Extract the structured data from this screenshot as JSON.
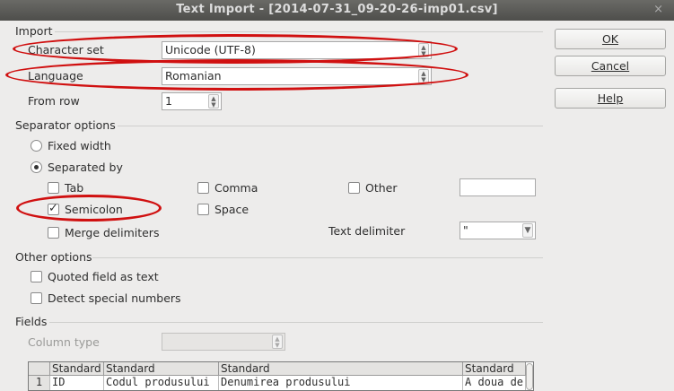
{
  "window": {
    "title": "Text Import - [2014-07-31_09-20-26-imp01.csv]",
    "close_glyph": "×"
  },
  "import": {
    "heading": "Import",
    "character_set_label": "Character set",
    "character_set_value": "Unicode (UTF-8)",
    "language_label": "Language",
    "language_value": "Romanian",
    "from_row_label": "From row",
    "from_row_value": "1"
  },
  "buttons": {
    "ok": "OK",
    "cancel": "Cancel",
    "help": "Help"
  },
  "separator_options": {
    "heading": "Separator options",
    "fixed_width": "Fixed width",
    "separated_by": "Separated by",
    "tab": "Tab",
    "comma": "Comma",
    "other": "Other",
    "other_value": "",
    "semicolon": "Semicolon",
    "space": "Space",
    "merge_delimiters": "Merge delimiters",
    "text_delimiter_label": "Text delimiter",
    "text_delimiter_value": "\""
  },
  "other_options": {
    "heading": "Other options",
    "quoted_field": "Quoted field as text",
    "detect_special": "Detect special numbers"
  },
  "fields": {
    "heading": "Fields",
    "column_type_label": "Column type",
    "column_type_value": "",
    "headers": [
      "Standard",
      "Standard",
      "Standard",
      "Standard"
    ],
    "rows": [
      {
        "num": "1",
        "cells": [
          "ID",
          "Codul produsului",
          "Denumirea produsului",
          "A doua de"
        ]
      }
    ]
  },
  "colors": {
    "highlight_oval": "#d01010",
    "title_bar": "#5a5a57",
    "background": "#edeceb"
  }
}
